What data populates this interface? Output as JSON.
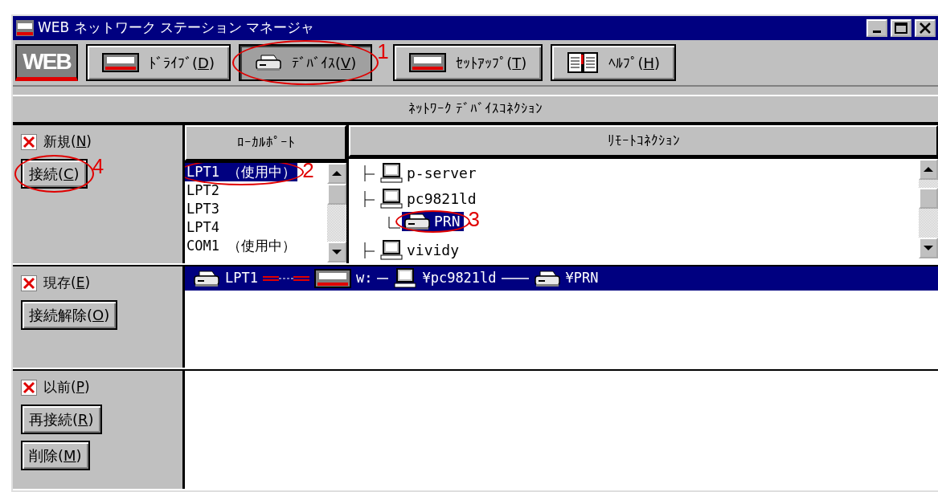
{
  "window": {
    "title": "WEB ネットワーク ステーション マネージャ"
  },
  "toolbar": {
    "logo": "WEB",
    "buttons": [
      {
        "kind": "drive",
        "label": "ﾄﾞﾗｲﾌﾞ(D)",
        "selected": false
      },
      {
        "kind": "device",
        "label": "ﾃﾞﾊﾞｲｽ(V)",
        "selected": true,
        "callout": "1"
      },
      {
        "kind": "setup",
        "label": "ｾｯﾄｱｯﾌﾟ(T)",
        "selected": false
      },
      {
        "kind": "help",
        "label": "ﾍﾙﾌﾟ(H)",
        "selected": false
      }
    ]
  },
  "header": "ﾈｯﾄﾜｰｸ ﾃﾞﾊﾞｲｽｺﾈｸｼｮﾝ",
  "new": {
    "label": "新規(N)",
    "checked": true,
    "buttons": [
      {
        "label": "接続(C)",
        "callout": "4"
      }
    ],
    "local_ports": {
      "heading": "ﾛｰｶﾙﾎﾟｰﾄ",
      "items": [
        {
          "label": "LPT1 （使用中）",
          "selected": true,
          "callout": "2"
        },
        {
          "label": "LPT2",
          "selected": false
        },
        {
          "label": "LPT3",
          "selected": false
        },
        {
          "label": "LPT4",
          "selected": false
        },
        {
          "label": "COM1 （使用中）",
          "selected": false
        }
      ]
    },
    "remote": {
      "heading": "ﾘﾓｰﾄｺﾈｸｼｮﾝ",
      "items": [
        {
          "label": "p-server",
          "kind": "computer",
          "selected": false
        },
        {
          "label": "pc9821ld",
          "kind": "computer",
          "selected": false,
          "children": [
            {
              "label": "PRN",
              "kind": "printer",
              "selected": true,
              "callout": "3"
            }
          ]
        },
        {
          "label": "vividy",
          "kind": "computer",
          "selected": false
        }
      ]
    }
  },
  "existing": {
    "label": "現存(E)",
    "checked": true,
    "buttons": [
      {
        "label": "接続解除(O)"
      }
    ],
    "rows": [
      {
        "selected": true,
        "segments": [
          {
            "kind": "printer",
            "text": "LPT1"
          },
          {
            "kind": "link"
          },
          {
            "kind": "web",
            "text": "w:"
          },
          {
            "kind": "computer",
            "text": "¥pc9821ld"
          },
          {
            "kind": "printer",
            "text": "¥PRN"
          }
        ]
      }
    ]
  },
  "previous": {
    "label": "以前(P)",
    "checked": true,
    "buttons": [
      {
        "label": "再接続(R)"
      },
      {
        "label": "削除(M)"
      }
    ]
  }
}
